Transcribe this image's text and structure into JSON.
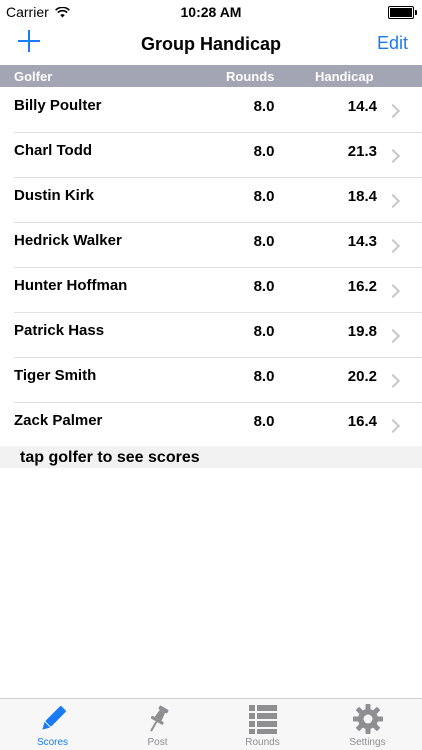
{
  "status": {
    "carrier": "Carrier",
    "time": "10:28 AM"
  },
  "nav": {
    "title": "Group Handicap",
    "edit_label": "Edit"
  },
  "table": {
    "headers": {
      "golfer": "Golfer",
      "rounds": "Rounds",
      "handicap": "Handicap"
    },
    "rows": [
      {
        "name": "Billy Poulter",
        "rounds": "8.0",
        "handicap": "14.4"
      },
      {
        "name": "Charl Todd",
        "rounds": "8.0",
        "handicap": "21.3"
      },
      {
        "name": "Dustin Kirk",
        "rounds": "8.0",
        "handicap": "18.4"
      },
      {
        "name": "Hedrick Walker",
        "rounds": "8.0",
        "handicap": "14.3"
      },
      {
        "name": "Hunter Hoffman",
        "rounds": "8.0",
        "handicap": "16.2"
      },
      {
        "name": "Patrick Hass",
        "rounds": "8.0",
        "handicap": "19.8"
      },
      {
        "name": "Tiger Smith",
        "rounds": "8.0",
        "handicap": "20.2"
      },
      {
        "name": "Zack Palmer",
        "rounds": "8.0",
        "handicap": "16.4"
      }
    ]
  },
  "hint": "tap golfer to see scores",
  "tabs": [
    {
      "label": "Scores",
      "icon": "pencil-icon",
      "active": true
    },
    {
      "label": "Post",
      "icon": "pin-icon",
      "active": false
    },
    {
      "label": "Rounds",
      "icon": "list-icon",
      "active": false
    },
    {
      "label": "Settings",
      "icon": "gear-icon",
      "active": false
    }
  ],
  "colors": {
    "accent": "#1a7cf5",
    "header_bg": "#a3a4b4",
    "inactive_tab": "#8e8e93"
  }
}
